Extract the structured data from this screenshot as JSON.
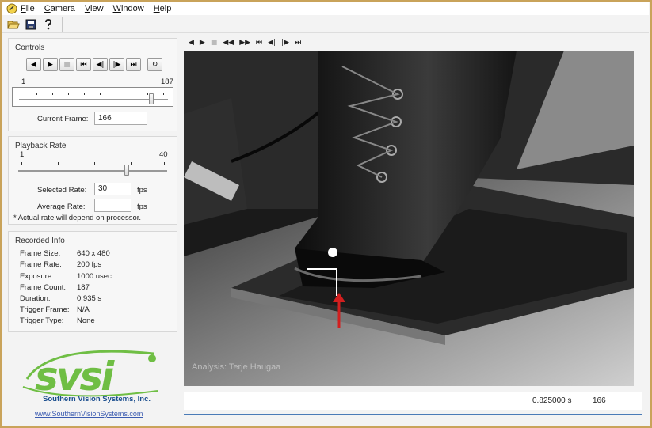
{
  "menu": [
    "File",
    "Camera",
    "View",
    "Window",
    "Help"
  ],
  "menu_underline": [
    "F",
    "C",
    "V",
    "W",
    "H"
  ],
  "menu_rest": [
    "ile",
    "amera",
    "iew",
    "indow",
    "elp"
  ],
  "toolbar": {
    "icons": [
      "open-folder-icon",
      "save-disk-icon",
      "help-icon"
    ]
  },
  "controls": {
    "title": "Controls",
    "buttons": [
      "◀",
      "▶",
      "■",
      "⏮",
      "◀|",
      "|▶",
      "⏭",
      "↻"
    ],
    "slider_min": "1",
    "slider_max": "187",
    "current_frame_label": "Current Frame:",
    "current_frame": "166"
  },
  "playback": {
    "title": "Playback Rate",
    "min": "1",
    "max": "40",
    "selected_label": "Selected Rate:",
    "selected_value": "30",
    "average_label": "Average Rate:",
    "average_value": "",
    "unit": "fps",
    "note": "* Actual rate will depend on processor."
  },
  "info": {
    "title": "Recorded Info",
    "rows": [
      {
        "label": "Frame Size:",
        "value": "640 x 480"
      },
      {
        "label": "Frame Rate:",
        "value": "200 fps"
      },
      {
        "label": "Exposure:",
        "value": "1000 usec"
      },
      {
        "label": "Frame Count:",
        "value": "187"
      },
      {
        "label": "Duration:",
        "value": "0.935 s"
      },
      {
        "label": "Trigger Frame:",
        "value": "N/A"
      },
      {
        "label": "Trigger Type:",
        "value": "None"
      }
    ]
  },
  "logo": {
    "text": "svsi",
    "company": "Southern Vision Systems, Inc.",
    "link": "www.SouthernVisionSystems.com"
  },
  "player_toolbar": [
    "◀",
    "▶",
    "■",
    "◀◀",
    "▶▶",
    "⏮",
    "◀|",
    "|▶",
    "⏭"
  ],
  "video": {
    "watermark": "Analysis: Terje Haugaa"
  },
  "status": {
    "time": "0.825000 s",
    "frame": "166"
  },
  "colors": {
    "logo_green": "#6fbe44",
    "logo_blue": "#1c4f8f",
    "arrow_red": "#d21f1f",
    "frame_border": "#c9a35a"
  }
}
